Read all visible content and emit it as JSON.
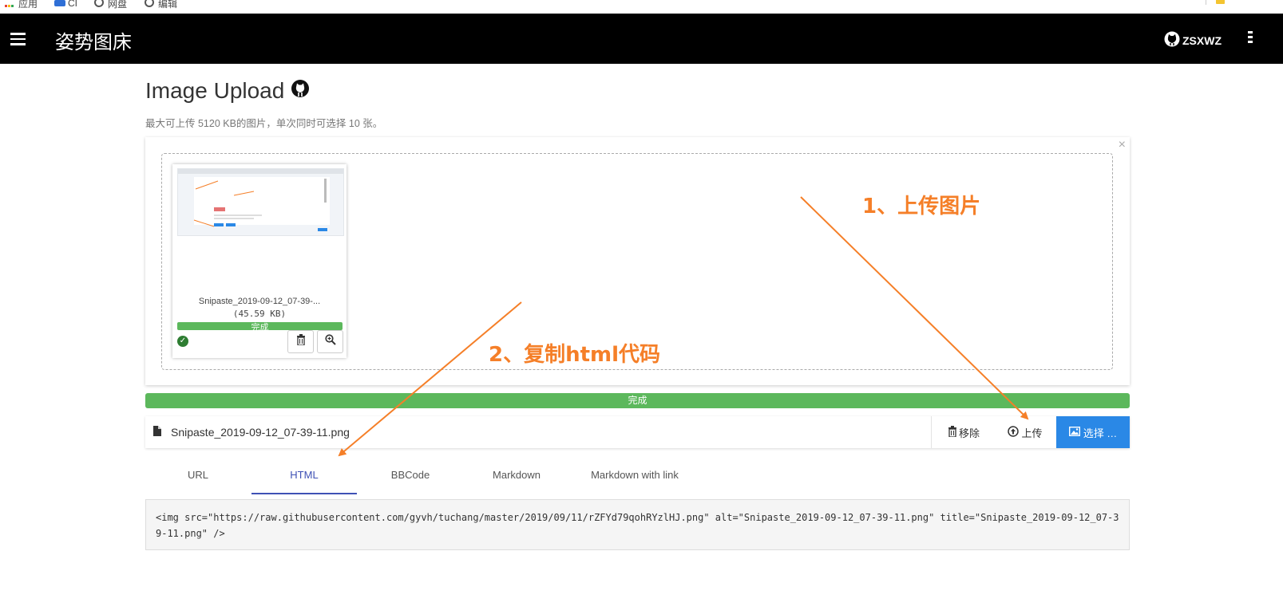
{
  "bookmarks": [
    {
      "label": "应用",
      "icon": "apps-grid-icon"
    },
    {
      "label": "CI",
      "icon": "folder-icon"
    },
    {
      "label": "网盘",
      "icon": "globe-icon"
    },
    {
      "label": "编辑",
      "icon": "globe-icon"
    }
  ],
  "navbar": {
    "brand": "姿势图床",
    "username": "ZSXWZ"
  },
  "page": {
    "title": "Image Upload",
    "subtitle": "最大可上传 5120 KB的图片，单次同时可选择 10 张。"
  },
  "preview": {
    "file_name": "Snipaste_2019-09-12_07-39-...",
    "file_size": "(45.59 KB)",
    "status": "完成",
    "progress": 1.0,
    "close_symbol": "×"
  },
  "progress": {
    "label": "完成",
    "value": 1.0
  },
  "file_input": {
    "caption": "Snipaste_2019-09-12_07-39-11.png",
    "remove_label": "移除",
    "upload_label": "上传",
    "browse_label": "选择 …"
  },
  "tabs": [
    {
      "label": "URL",
      "active": false
    },
    {
      "label": "HTML",
      "active": true
    },
    {
      "label": "BBCode",
      "active": false
    },
    {
      "label": "Markdown",
      "active": false
    },
    {
      "label": "Markdown with link",
      "active": false
    }
  ],
  "code_output": "<img src=\"https://raw.githubusercontent.com/gyvh/tuchang/master/2019/09/11/rZFYd79qohRYzlHJ.png\" alt=\"Snipaste_2019-09-12_07-39-11.png\" title=\"Snipaste_2019-09-12_07-39-11.png\" />",
  "annotations": {
    "step1": "1、上传图片",
    "step2": "2、复制html代码"
  },
  "colors": {
    "navbar": "#000000",
    "success": "#5cb85c",
    "primary": "#2a88e6",
    "active_tab": "#3f51b5",
    "annotation": "#f57f28"
  }
}
